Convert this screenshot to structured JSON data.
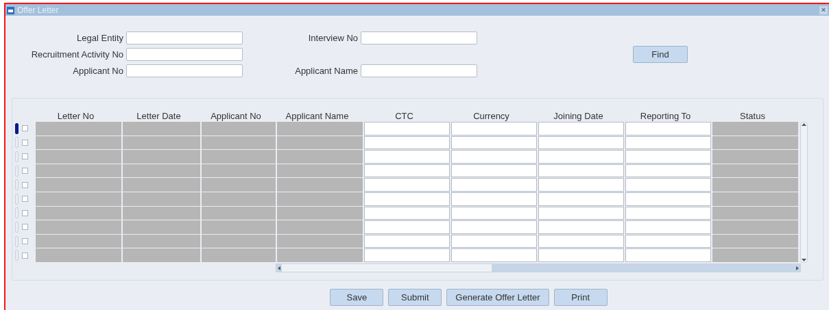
{
  "window": {
    "title": "Offer Letter",
    "close": "×"
  },
  "search_fields": [
    {
      "label": "Legal Entity"
    },
    {
      "label": "Interview No"
    },
    {
      "label": "Recruitment Activity No"
    },
    {
      "label": "Applicant No"
    },
    {
      "label": "Applicant Name"
    }
  ],
  "find_button": "Find",
  "table": {
    "columns": [
      {
        "label": "Letter No",
        "editable": false
      },
      {
        "label": "Letter Date",
        "editable": false
      },
      {
        "label": "Applicant No",
        "editable": false
      },
      {
        "label": "Applicant Name",
        "editable": false
      },
      {
        "label": "CTC",
        "editable": true
      },
      {
        "label": "Currency",
        "editable": true
      },
      {
        "label": "Joining Date",
        "editable": true
      },
      {
        "label": "Reporting To",
        "editable": true
      },
      {
        "label": "Status",
        "editable": false
      }
    ],
    "rows": [
      {
        "current": true,
        "checked": false
      },
      {
        "current": false,
        "checked": false
      },
      {
        "current": false,
        "checked": false
      },
      {
        "current": false,
        "checked": false
      },
      {
        "current": false,
        "checked": false
      },
      {
        "current": false,
        "checked": false
      },
      {
        "current": false,
        "checked": false
      },
      {
        "current": false,
        "checked": false
      },
      {
        "current": false,
        "checked": false
      },
      {
        "current": false,
        "checked": false
      }
    ]
  },
  "buttons": [
    "Save",
    "Submit",
    "Generate Offer Letter",
    "Print"
  ]
}
